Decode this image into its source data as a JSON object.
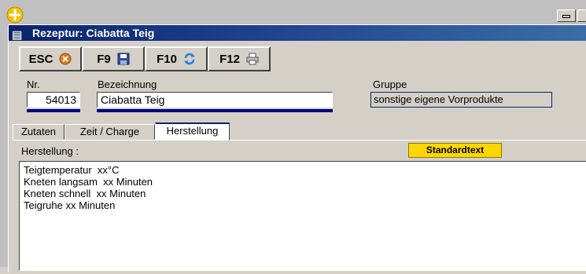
{
  "window": {
    "title": "Rezeptur: Ciabatta Teig"
  },
  "toolbar": {
    "buttons": [
      {
        "label": "ESC",
        "icon": "cancel-icon"
      },
      {
        "label": "F9",
        "icon": "save-disk-icon"
      },
      {
        "label": "F10",
        "icon": "refresh-icon"
      },
      {
        "label": "F12",
        "icon": "printer-icon"
      }
    ]
  },
  "form": {
    "nr_label": "Nr.",
    "nr_value": "54013",
    "bezeichnung_label": "Bezeichnung",
    "bezeichnung_value": "Ciabatta Teig",
    "gruppe_label": "Gruppe",
    "gruppe_value": "sonstige eigene Vorprodukte"
  },
  "tabs": [
    {
      "label": "Zutaten"
    },
    {
      "label": "Zeit / Charge"
    },
    {
      "label": "Herstellung",
      "active": true
    }
  ],
  "herstellung": {
    "label": "Herstellung :",
    "standard_button": "Standardtext",
    "lines": [
      "Teigtemperatur  xx°C",
      "Kneten langsam  xx Minuten",
      "Kneten schnell  xx Minuten",
      "Teigruhe xx Minuten"
    ]
  },
  "colors": {
    "titlebar": "#0a246a",
    "accent_underline": "#000080",
    "standard_button": "#ffd700"
  }
}
